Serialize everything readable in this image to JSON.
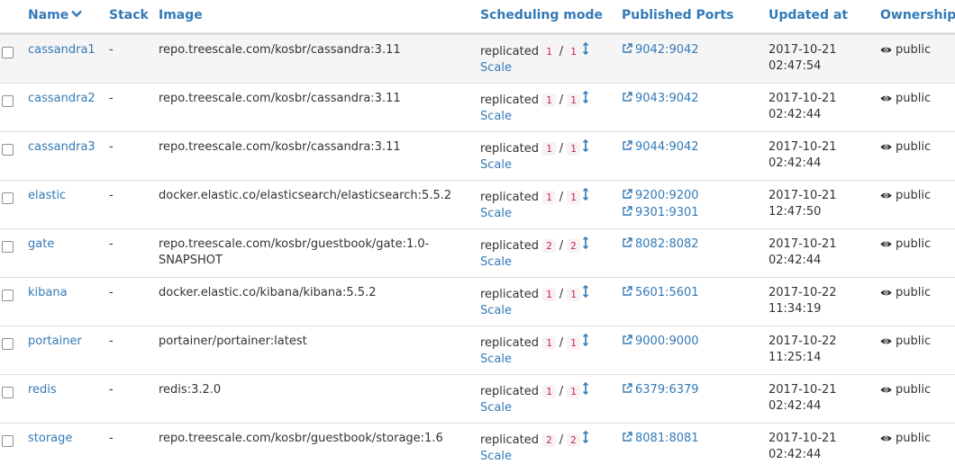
{
  "columns": {
    "name": "Name",
    "stack": "Stack",
    "image": "Image",
    "scheduling": "Scheduling mode",
    "ports": "Published Ports",
    "updated": "Updated at",
    "ownership": "Ownership"
  },
  "scale_label": "Scale",
  "services": [
    {
      "name": "cassandra1",
      "stack": "-",
      "image": "repo.treescale.com/kosbr/cassandra:3.11",
      "mode": "replicated",
      "running": "1",
      "desired": "1",
      "ports": [
        "9042:9042"
      ],
      "updated_date": "2017-10-21",
      "updated_time": "02:47:54",
      "ownership": "public"
    },
    {
      "name": "cassandra2",
      "stack": "-",
      "image": "repo.treescale.com/kosbr/cassandra:3.11",
      "mode": "replicated",
      "running": "1",
      "desired": "1",
      "ports": [
        "9043:9042"
      ],
      "updated_date": "2017-10-21",
      "updated_time": "02:42:44",
      "ownership": "public"
    },
    {
      "name": "cassandra3",
      "stack": "-",
      "image": "repo.treescale.com/kosbr/cassandra:3.11",
      "mode": "replicated",
      "running": "1",
      "desired": "1",
      "ports": [
        "9044:9042"
      ],
      "updated_date": "2017-10-21",
      "updated_time": "02:42:44",
      "ownership": "public"
    },
    {
      "name": "elastic",
      "stack": "-",
      "image": "docker.elastic.co/elasticsearch/elasticsearch:5.5.2",
      "mode": "replicated",
      "running": "1",
      "desired": "1",
      "ports": [
        "9200:9200",
        "9301:9301"
      ],
      "updated_date": "2017-10-21",
      "updated_time": "12:47:50",
      "ownership": "public"
    },
    {
      "name": "gate",
      "stack": "-",
      "image": "repo.treescale.com/kosbr/guestbook/gate:1.0-SNAPSHOT",
      "mode": "replicated",
      "running": "2",
      "desired": "2",
      "ports": [
        "8082:8082"
      ],
      "updated_date": "2017-10-21",
      "updated_time": "02:42:44",
      "ownership": "public"
    },
    {
      "name": "kibana",
      "stack": "-",
      "image": "docker.elastic.co/kibana/kibana:5.5.2",
      "mode": "replicated",
      "running": "1",
      "desired": "1",
      "ports": [
        "5601:5601"
      ],
      "updated_date": "2017-10-22",
      "updated_time": "11:34:19",
      "ownership": "public"
    },
    {
      "name": "portainer",
      "stack": "-",
      "image": "portainer/portainer:latest",
      "mode": "replicated",
      "running": "1",
      "desired": "1",
      "ports": [
        "9000:9000"
      ],
      "updated_date": "2017-10-22",
      "updated_time": "11:25:14",
      "ownership": "public"
    },
    {
      "name": "redis",
      "stack": "-",
      "image": "redis:3.2.0",
      "mode": "replicated",
      "running": "1",
      "desired": "1",
      "ports": [
        "6379:6379"
      ],
      "updated_date": "2017-10-21",
      "updated_time": "02:42:44",
      "ownership": "public"
    },
    {
      "name": "storage",
      "stack": "-",
      "image": "repo.treescale.com/kosbr/guestbook/storage:1.6",
      "mode": "replicated",
      "running": "2",
      "desired": "2",
      "ports": [
        "8081:8081"
      ],
      "updated_date": "2017-10-21",
      "updated_time": "02:42:44",
      "ownership": "public"
    }
  ]
}
